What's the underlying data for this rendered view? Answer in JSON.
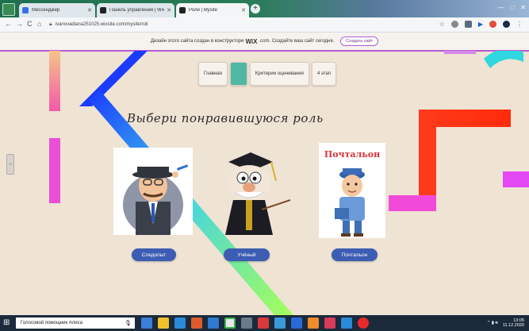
{
  "browser": {
    "tabs": [
      {
        "label": "Мессенджер",
        "fav_color": "#3a6fe0"
      },
      {
        "label": "Панель управления | Wix.com",
        "fav_color": "#222222"
      },
      {
        "label": "Роли | Mysite",
        "fav_color": "#222222"
      }
    ],
    "new_tab": "+",
    "url": "ivanovadiana251025.wixsite.com/mysite/roli",
    "nav": {
      "back": "←",
      "forward": "→",
      "reload": "C",
      "home": "⌂"
    }
  },
  "wix_banner": {
    "text": "Дизайн этого сайта создан в конструкторе",
    "brand": "WiX",
    "suffix": ".com. Создайте ваш сайт сегодня.",
    "button": "Создать сайт"
  },
  "site": {
    "menu": [
      {
        "label": "Главная"
      },
      {
        "label": ""
      },
      {
        "label": "Критерии оценивания"
      },
      {
        "label": "4 этап"
      }
    ],
    "heading": "Выбери понравившуюся роль",
    "roles": [
      {
        "label": "Следопыт"
      },
      {
        "label": "Учёный"
      },
      {
        "label": "Почтальон"
      }
    ],
    "postman_sign": "Почтальон",
    "side_tab": "‹‹"
  },
  "taskbar": {
    "search_text": "Голосовой помощник Алиса",
    "time": "13:05",
    "date": "11.12.2020"
  },
  "colors": {
    "accent_button": "#3c5db3",
    "menu_active": "#4fb8a3",
    "wix_border": "#b65bd0"
  }
}
